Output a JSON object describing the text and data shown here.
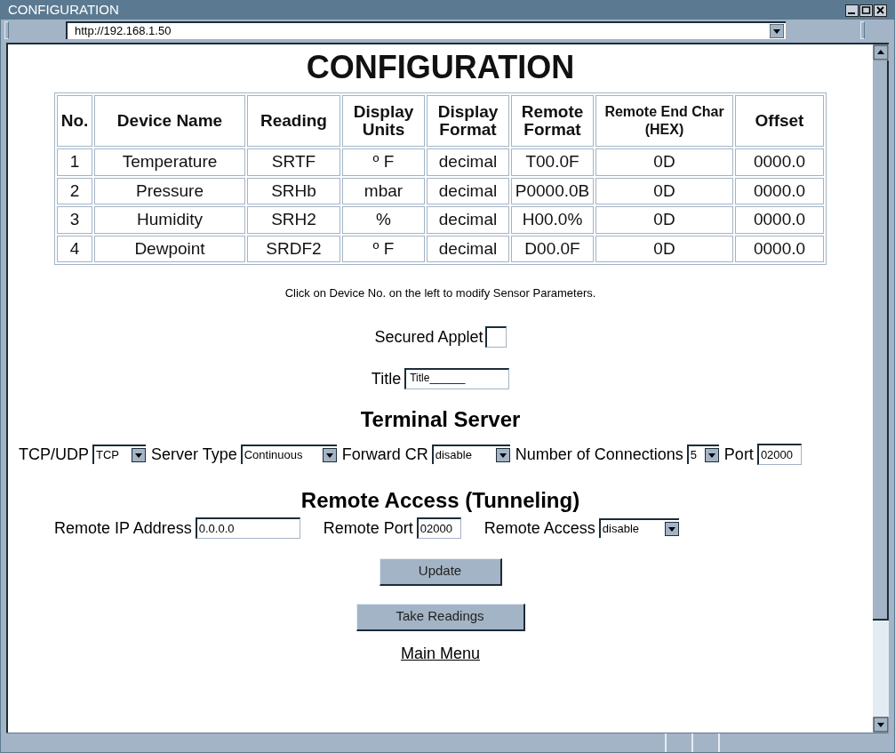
{
  "window": {
    "title": "CONFIGURATION"
  },
  "address_bar": {
    "url": "http://192.168.1.50"
  },
  "page_title": "CONFIGURATION",
  "table": {
    "columns": [
      "No.",
      "Device Name",
      "Reading",
      "Display Units",
      "Display Format",
      "Remote Format",
      "Remote End Char (HEX)",
      "Offset"
    ],
    "rows": [
      [
        "1",
        "Temperature",
        "SRTF",
        "º F",
        "decimal",
        "T00.0F",
        "0D",
        "0000.0"
      ],
      [
        "2",
        "Pressure",
        "SRHb",
        "mbar",
        "decimal",
        "P0000.0B",
        "0D",
        "0000.0"
      ],
      [
        "3",
        "Humidity",
        "SRH2",
        "%",
        "decimal",
        "H00.0%",
        "0D",
        "0000.0"
      ],
      [
        "4",
        "Dewpoint",
        "SRDF2",
        "º F",
        "decimal",
        "D00.0F",
        "0D",
        "0000.0"
      ]
    ]
  },
  "hint": "Click on Device No. on the left to modify Sensor Parameters.",
  "secured_applet": {
    "label": "Secured Applet",
    "checked": false
  },
  "title_field": {
    "label": "Title",
    "value": "Title______"
  },
  "terminal_server": {
    "heading": "Terminal Server",
    "fields": [
      {
        "kind": "select",
        "label": "TCP/UDP",
        "value": "TCP"
      },
      {
        "kind": "select",
        "label": "Server Type",
        "value": "Continuous"
      },
      {
        "kind": "select",
        "label": "Forward CR",
        "value": "disable"
      },
      {
        "kind": "select",
        "label": "Number of Connections",
        "value": "5"
      },
      {
        "kind": "input",
        "label": "Port",
        "value": "02000"
      }
    ]
  },
  "remote_access": {
    "heading": "Remote Access (Tunneling)",
    "fields": [
      {
        "kind": "input",
        "label": "Remote IP Address",
        "value": "0.0.0.0"
      },
      {
        "kind": "input",
        "label": "Remote Port",
        "value": "02000"
      },
      {
        "kind": "select",
        "label": "Remote Access",
        "value": "disable"
      }
    ]
  },
  "buttons": [
    "Update",
    "Take Readings"
  ],
  "link": "Main Menu"
}
